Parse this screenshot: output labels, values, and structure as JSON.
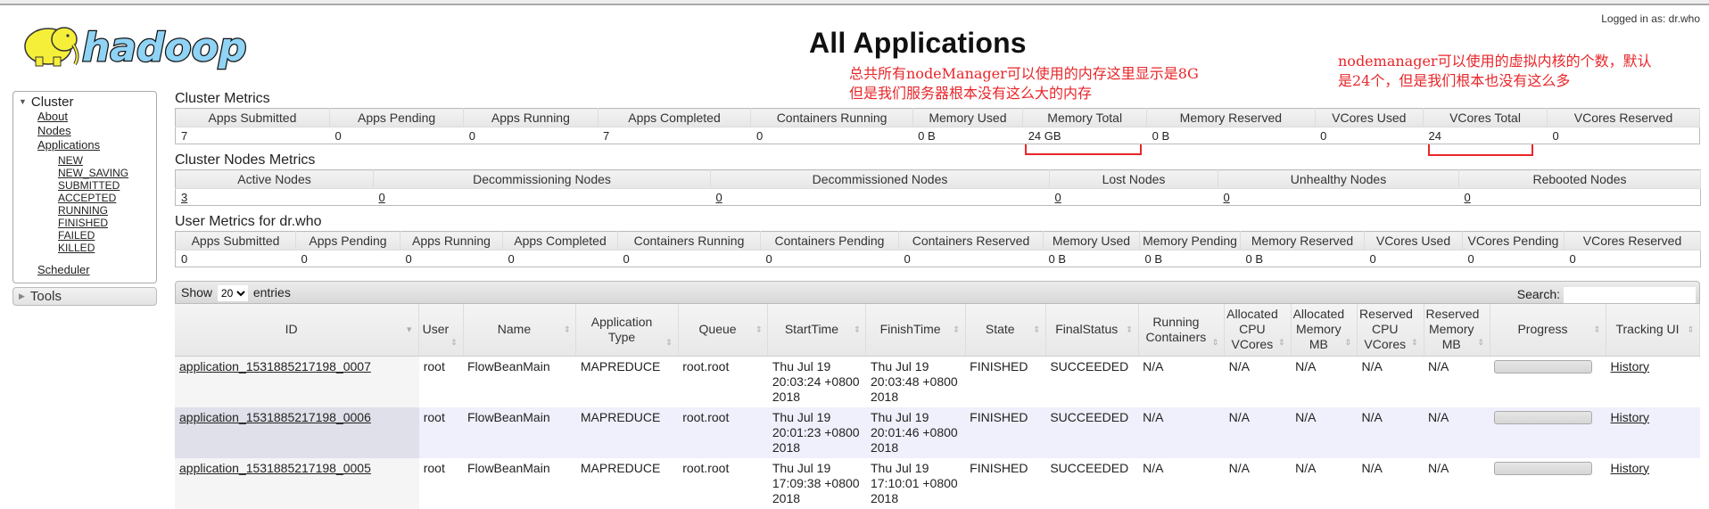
{
  "header": {
    "logo_text": "hadoop",
    "title": "All Applications",
    "logged_in": "Logged in as: dr.who"
  },
  "annotations": {
    "memory_line1": "总共所有nodeManager可以使用的内存这里显示是8G",
    "memory_line2": "但是我们服务器根本没有这么大的内存",
    "vcores_line1": "nodemanager可以使用的虚拟内核的个数，默认",
    "vcores_line2": "是24个，但是我们根本也没有这么多",
    "color": "#e8262a"
  },
  "nav": {
    "cluster_label": "Cluster",
    "links": [
      "About",
      "Nodes",
      "Applications"
    ],
    "app_states": [
      "NEW",
      "NEW_SAVING",
      "SUBMITTED",
      "ACCEPTED",
      "RUNNING",
      "FINISHED",
      "FAILED",
      "KILLED"
    ],
    "scheduler": "Scheduler",
    "tools_label": "Tools"
  },
  "cluster_metrics": {
    "title": "Cluster Metrics",
    "headers": [
      "Apps Submitted",
      "Apps Pending",
      "Apps Running",
      "Apps Completed",
      "Containers Running",
      "Memory Used",
      "Memory Total",
      "Memory Reserved",
      "VCores Used",
      "VCores Total",
      "VCores Reserved"
    ],
    "values": [
      "7",
      "0",
      "0",
      "7",
      "0",
      "0 B",
      "24 GB",
      "0 B",
      "0",
      "24",
      "0"
    ]
  },
  "cluster_nodes_metrics": {
    "title": "Cluster Nodes Metrics",
    "headers": [
      "Active Nodes",
      "Decommissioning Nodes",
      "Decommissioned Nodes",
      "Lost Nodes",
      "Unhealthy Nodes",
      "Rebooted Nodes"
    ],
    "values": [
      "3",
      "0",
      "0",
      "0",
      "0",
      "0"
    ]
  },
  "user_metrics": {
    "title": "User Metrics for dr.who",
    "headers": [
      "Apps Submitted",
      "Apps Pending",
      "Apps Running",
      "Apps Completed",
      "Containers Running",
      "Containers Pending",
      "Containers Reserved",
      "Memory Used",
      "Memory Pending",
      "Memory Reserved",
      "VCores Used",
      "VCores Pending",
      "VCores Reserved"
    ],
    "values": [
      "0",
      "0",
      "0",
      "0",
      "0",
      "0",
      "0",
      "0 B",
      "0 B",
      "0 B",
      "0",
      "0",
      "0"
    ]
  },
  "apps_table": {
    "show_label": "Show",
    "page_size": "20",
    "entries_label": "entries",
    "search_label": "Search:",
    "search_value": "",
    "columns": [
      "ID",
      "User",
      "Name",
      "Application Type",
      "Queue",
      "StartTime",
      "FinishTime",
      "State",
      "FinalStatus",
      "Running Containers",
      "Allocated CPU VCores",
      "Allocated Memory MB",
      "Reserved CPU VCores",
      "Reserved Memory MB",
      "Progress",
      "Tracking UI"
    ],
    "rows": [
      {
        "id": "application_1531885217198_0007",
        "user": "root",
        "name": "FlowBeanMain",
        "type": "MAPREDUCE",
        "queue": "root.root",
        "start": "Thu Jul 19 20:03:24 +0800 2018",
        "finish": "Thu Jul 19 20:03:48 +0800 2018",
        "state": "FINISHED",
        "final": "SUCCEEDED",
        "running": "N/A",
        "alloc_cpu": "N/A",
        "alloc_mem": "N/A",
        "res_cpu": "N/A",
        "res_mem": "N/A",
        "progress": 0,
        "tracking": "History"
      },
      {
        "id": "application_1531885217198_0006",
        "user": "root",
        "name": "FlowBeanMain",
        "type": "MAPREDUCE",
        "queue": "root.root",
        "start": "Thu Jul 19 20:01:23 +0800 2018",
        "finish": "Thu Jul 19 20:01:46 +0800 2018",
        "state": "FINISHED",
        "final": "SUCCEEDED",
        "running": "N/A",
        "alloc_cpu": "N/A",
        "alloc_mem": "N/A",
        "res_cpu": "N/A",
        "res_mem": "N/A",
        "progress": 0,
        "tracking": "History"
      },
      {
        "id": "application_1531885217198_0005",
        "user": "root",
        "name": "FlowBeanMain",
        "type": "MAPREDUCE",
        "queue": "root.root",
        "start": "Thu Jul 19 17:09:38 +0800 2018",
        "finish": "Thu Jul 19 17:10:01 +0800 2018",
        "state": "FINISHED",
        "final": "SUCCEEDED",
        "running": "N/A",
        "alloc_cpu": "N/A",
        "alloc_mem": "N/A",
        "res_cpu": "N/A",
        "res_mem": "N/A",
        "progress": 0,
        "tracking": "History"
      }
    ]
  }
}
